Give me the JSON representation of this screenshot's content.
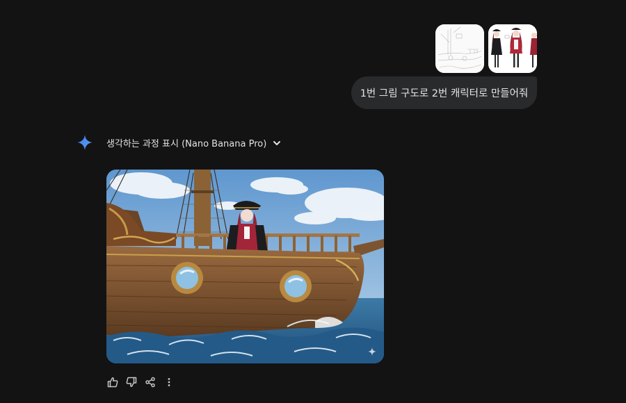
{
  "user_message": {
    "attachments": [
      {
        "name": "reference-sketch"
      },
      {
        "name": "character-sheet"
      }
    ],
    "text": "1번 그림 구도로 2번 캐릭터로 만들어줘"
  },
  "response": {
    "thinking_toggle_label": "생각하는 과정 표시 (Nano Banana Pro)",
    "image": {
      "name": "generated-pirate-ship-image"
    }
  },
  "actions": [
    "thumbs-up-icon",
    "thumbs-down-icon",
    "share-icon",
    "more-options-icon"
  ],
  "colors": {
    "background": "#131314",
    "bubble": "#282a2c",
    "text": "#e3e3e3",
    "gemini_accent": "#4a8cf0"
  }
}
